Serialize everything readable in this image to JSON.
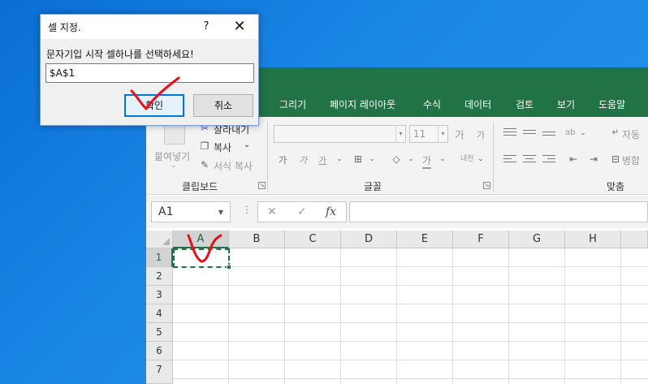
{
  "excel": {
    "menu": [
      "그리기",
      "페이지 레이아웃",
      "수식",
      "데이터",
      "검토",
      "보기",
      "도움말"
    ],
    "ribbon": {
      "clipboard": {
        "paste_label": "붙여넣기",
        "cut_label": "잘라내기",
        "copy_label": "복사",
        "format_painter_label": "서식 복사",
        "group_label": "클립보드"
      },
      "font": {
        "font_size": "11",
        "group_label": "글꼴",
        "bold_label": "가",
        "italic_label": "가",
        "underline_label": "가",
        "grow_label": "가",
        "shrink_label": "가",
        "font_color_label": "가",
        "phonetic_label": "내천"
      },
      "alignment": {
        "wrap_label": "자동",
        "merge_label": "병합",
        "group_label": "맞춤",
        "orientation_label": "ab"
      }
    },
    "formula_bar": {
      "name_box": "A1",
      "cancel": "✕",
      "enter": "✓",
      "fx": "fx"
    },
    "grid": {
      "columns": [
        "A",
        "B",
        "C",
        "D",
        "E",
        "F",
        "G",
        "H"
      ],
      "rows": [
        "1",
        "2",
        "3",
        "4",
        "5",
        "6",
        "7"
      ],
      "selected_column": "A",
      "selected_row": "1"
    }
  },
  "dialog": {
    "title": "셀 지정.",
    "help": "?",
    "close": "✕",
    "prompt": "문자기입 시작 셀하나를 선택하세요!",
    "input_value": "$A$1",
    "ok_label": "확인",
    "cancel_label": "취소"
  },
  "colors": {
    "excel_green": "#217346",
    "annotation_red": "#e8101a",
    "desktop_blue": "#1a86e6"
  }
}
